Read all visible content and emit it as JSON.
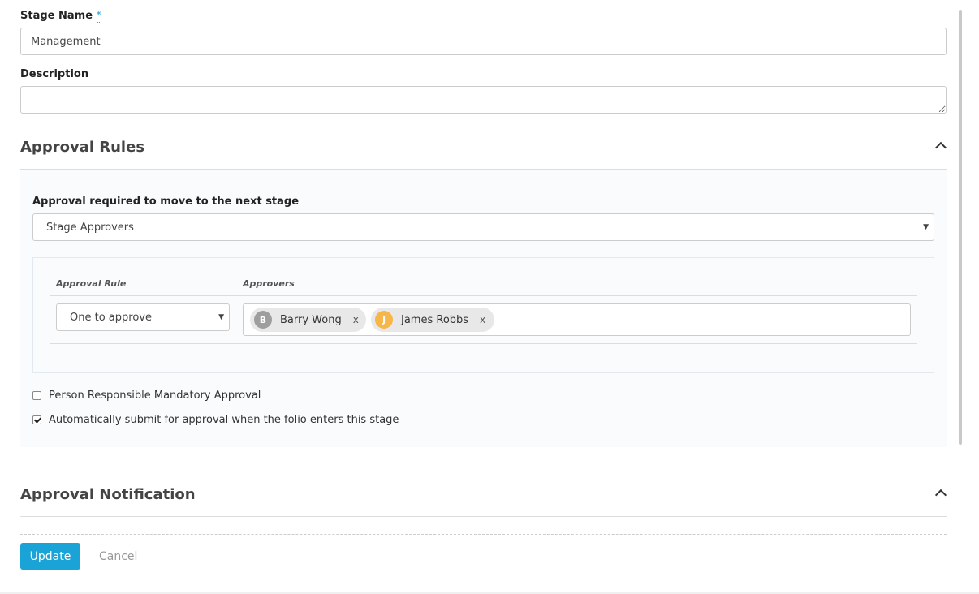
{
  "form": {
    "stage_name_label": "Stage Name",
    "required_mark": "*",
    "stage_name_value": "Management",
    "description_label": "Description",
    "description_value": ""
  },
  "approval_rules": {
    "title": "Approval Rules",
    "required_label": "Approval required to move to the next stage",
    "required_select_value": "Stage Approvers",
    "table": {
      "col_rule": "Approval Rule",
      "col_approvers": "Approvers",
      "rule_select_value": "One to approve",
      "approvers": [
        {
          "initial": "B",
          "name": "Barry Wong",
          "remove": "x",
          "color": "#9e9e9e"
        },
        {
          "initial": "J",
          "name": "James Robbs",
          "remove": "x",
          "color": "#f7b64a"
        }
      ]
    },
    "options": [
      {
        "label": "Person Responsible Mandatory Approval",
        "checked": false
      },
      {
        "label": "Automatically submit for approval when the folio enters this stage",
        "checked": true
      }
    ]
  },
  "approval_notification": {
    "title": "Approval Notification"
  },
  "actions": {
    "update_label": "Update",
    "cancel_label": "Cancel"
  },
  "colors": {
    "accent": "#1aa3d6",
    "panel_bg": "#f9fbfd"
  }
}
